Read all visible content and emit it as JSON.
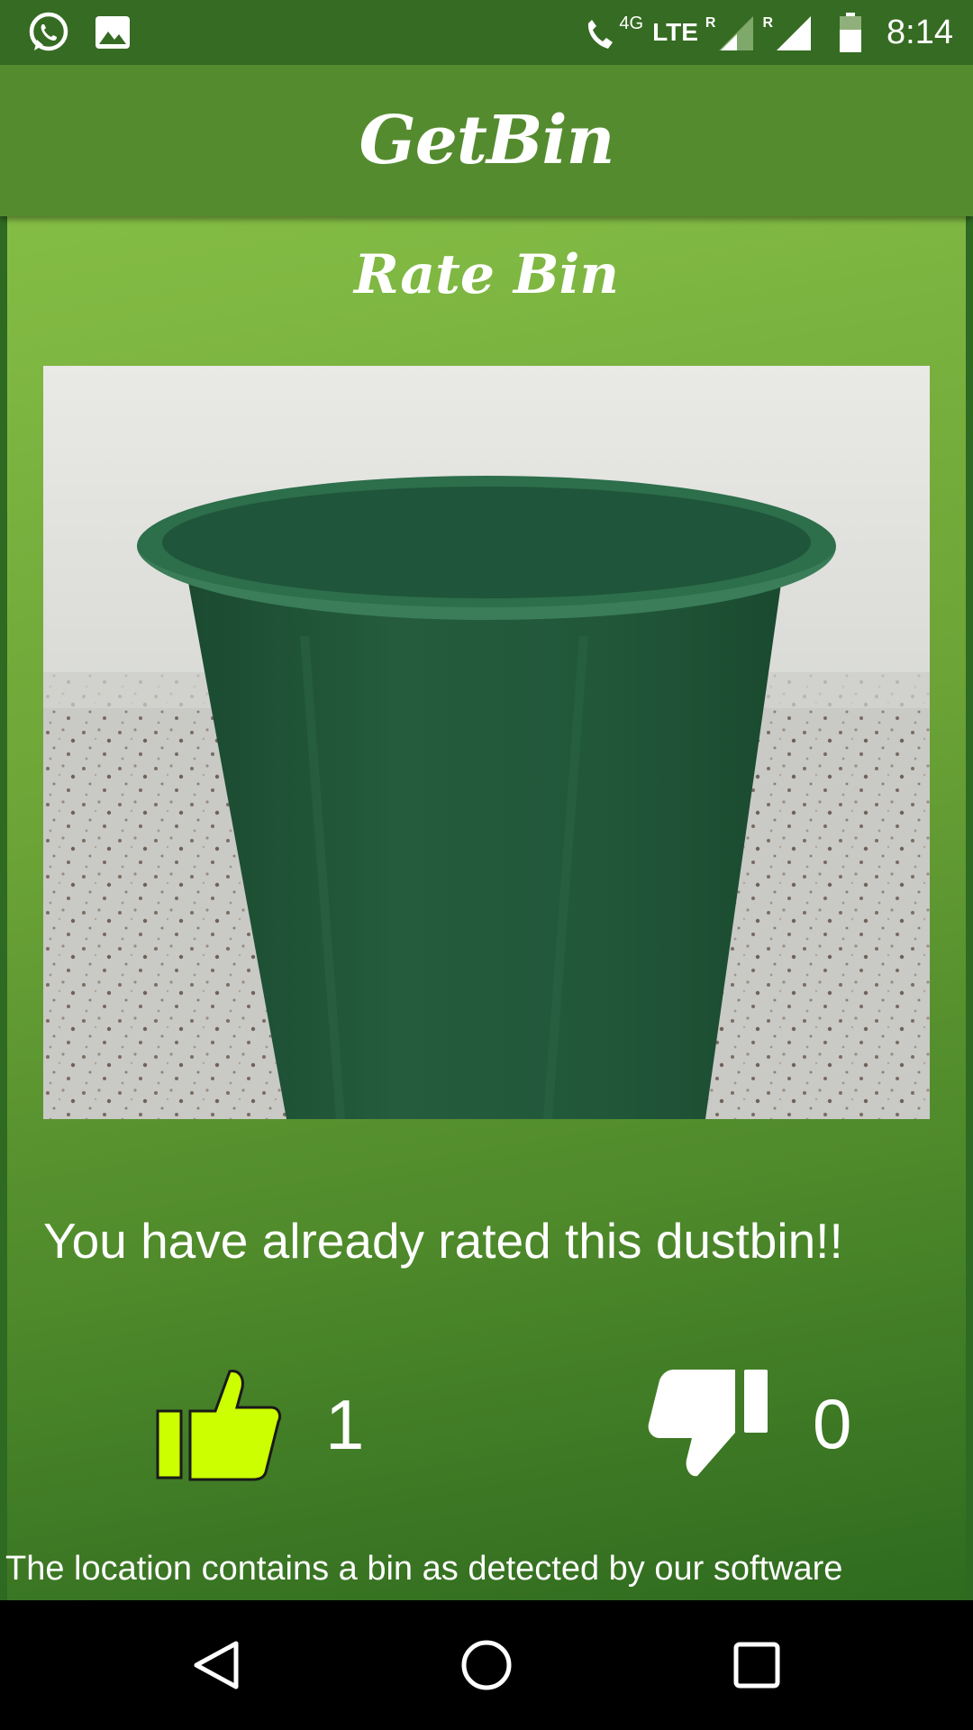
{
  "status_bar": {
    "network_label": "4G",
    "lte_label": "LTE",
    "roaming_1": "R",
    "roaming_2": "R",
    "time": "8:14"
  },
  "app_bar": {
    "title": "GetBin"
  },
  "rate_card": {
    "title": "Rate Bin",
    "photo_icon": "dustbin-photo",
    "message": "You have already rated this dustbin!!",
    "upvote": {
      "icon": "thumbs-up-icon",
      "count": "1",
      "color": "#ccff00"
    },
    "downvote": {
      "icon": "thumbs-down-icon",
      "count": "0",
      "color": "#ffffff"
    },
    "footer": "The location contains a bin as detected by our software"
  },
  "nav_bar": {
    "back_icon": "back-triangle-icon",
    "home_icon": "home-circle-icon",
    "recents_icon": "recents-square-icon"
  },
  "colors": {
    "status_bar": "#356b22",
    "app_bar": "#558b2f",
    "panel_top": "#84bd45",
    "panel_bottom": "#2f6b1f"
  }
}
